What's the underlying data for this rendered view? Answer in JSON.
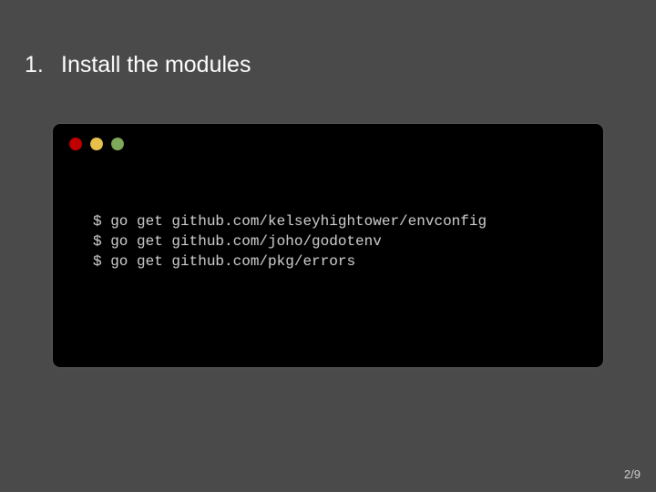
{
  "slide": {
    "title_number": "1.",
    "title_text": "Install the modules",
    "page_number": "2/9"
  },
  "terminal": {
    "window_dots": [
      {
        "name": "close",
        "color": "#c00000"
      },
      {
        "name": "minimize",
        "color": "#e6c04a"
      },
      {
        "name": "maximize",
        "color": "#7ea85a"
      }
    ],
    "lines": [
      "$ go get github.com/kelseyhightower/envconfig",
      "$ go get github.com/joho/godotenv",
      "$ go get github.com/pkg/errors"
    ]
  },
  "colors": {
    "background": "#4a4a4a",
    "terminal_background": "#000000",
    "title_text": "#ffffff",
    "code_text": "#d0d0d0"
  }
}
